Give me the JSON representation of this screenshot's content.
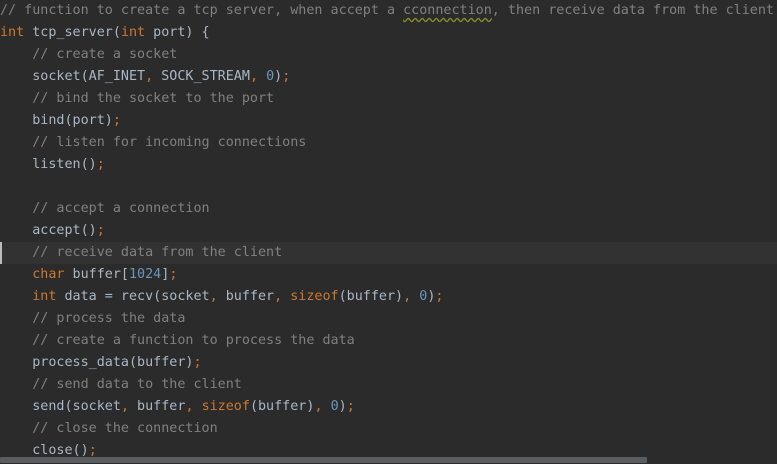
{
  "editor": {
    "current_line_index": 11,
    "lines": [
      {
        "tokens": [
          {
            "text": "// function to create a tcp server, when accept a ",
            "type": "comment"
          },
          {
            "text": "cconnection",
            "type": "comment typo"
          },
          {
            "text": ", then receive data from the client",
            "type": "comment"
          }
        ]
      },
      {
        "tokens": [
          {
            "text": "int",
            "type": "keyword"
          },
          {
            "text": " tcp_server(",
            "type": "fn"
          },
          {
            "text": "int",
            "type": "keyword"
          },
          {
            "text": " port) {",
            "type": "fn"
          }
        ]
      },
      {
        "tokens": [
          {
            "text": "    // create a socket",
            "type": "comment"
          }
        ]
      },
      {
        "tokens": [
          {
            "text": "    socket(AF_INET",
            "type": "fn"
          },
          {
            "text": ",",
            "type": "punct"
          },
          {
            "text": " SOCK_STREAM",
            "type": "fn"
          },
          {
            "text": ",",
            "type": "punct"
          },
          {
            "text": " ",
            "type": "fn"
          },
          {
            "text": "0",
            "type": "number"
          },
          {
            "text": ")",
            "type": "fn"
          },
          {
            "text": ";",
            "type": "punct"
          }
        ]
      },
      {
        "tokens": [
          {
            "text": "    // bind the socket to the port",
            "type": "comment"
          }
        ]
      },
      {
        "tokens": [
          {
            "text": "    bind(port)",
            "type": "fn"
          },
          {
            "text": ";",
            "type": "punct"
          }
        ]
      },
      {
        "tokens": [
          {
            "text": "    // listen for incoming connections",
            "type": "comment"
          }
        ]
      },
      {
        "tokens": [
          {
            "text": "    listen()",
            "type": "fn"
          },
          {
            "text": ";",
            "type": "punct"
          }
        ]
      },
      {
        "tokens": [
          {
            "text": "",
            "type": "fn"
          }
        ]
      },
      {
        "tokens": [
          {
            "text": "    // accept a connection",
            "type": "comment"
          }
        ]
      },
      {
        "tokens": [
          {
            "text": "    accept()",
            "type": "fn"
          },
          {
            "text": ";",
            "type": "punct"
          }
        ]
      },
      {
        "tokens": [
          {
            "text": "    // receive data from the client",
            "type": "comment"
          }
        ]
      },
      {
        "tokens": [
          {
            "text": "    ",
            "type": "fn"
          },
          {
            "text": "char",
            "type": "keyword"
          },
          {
            "text": " buffer[",
            "type": "fn"
          },
          {
            "text": "1024",
            "type": "number"
          },
          {
            "text": "]",
            "type": "fn"
          },
          {
            "text": ";",
            "type": "punct"
          }
        ]
      },
      {
        "tokens": [
          {
            "text": "    ",
            "type": "fn"
          },
          {
            "text": "int",
            "type": "keyword"
          },
          {
            "text": " data = recv(socket",
            "type": "fn"
          },
          {
            "text": ",",
            "type": "punct"
          },
          {
            "text": " buffer",
            "type": "fn"
          },
          {
            "text": ",",
            "type": "punct"
          },
          {
            "text": " ",
            "type": "fn"
          },
          {
            "text": "sizeof",
            "type": "keyword"
          },
          {
            "text": "(buffer)",
            "type": "fn"
          },
          {
            "text": ",",
            "type": "punct"
          },
          {
            "text": " ",
            "type": "fn"
          },
          {
            "text": "0",
            "type": "number"
          },
          {
            "text": ")",
            "type": "fn"
          },
          {
            "text": ";",
            "type": "punct"
          }
        ]
      },
      {
        "tokens": [
          {
            "text": "    // process the data",
            "type": "comment"
          }
        ]
      },
      {
        "tokens": [
          {
            "text": "    // create a function to process the data",
            "type": "comment"
          }
        ]
      },
      {
        "tokens": [
          {
            "text": "    process_data(buffer)",
            "type": "fn"
          },
          {
            "text": ";",
            "type": "punct"
          }
        ]
      },
      {
        "tokens": [
          {
            "text": "    // send data to the client",
            "type": "comment"
          }
        ]
      },
      {
        "tokens": [
          {
            "text": "    send(socket",
            "type": "fn"
          },
          {
            "text": ",",
            "type": "punct"
          },
          {
            "text": " buffer",
            "type": "fn"
          },
          {
            "text": ",",
            "type": "punct"
          },
          {
            "text": " ",
            "type": "fn"
          },
          {
            "text": "sizeof",
            "type": "keyword"
          },
          {
            "text": "(buffer)",
            "type": "fn"
          },
          {
            "text": ",",
            "type": "punct"
          },
          {
            "text": " ",
            "type": "fn"
          },
          {
            "text": "0",
            "type": "number"
          },
          {
            "text": ")",
            "type": "fn"
          },
          {
            "text": ";",
            "type": "punct"
          }
        ]
      },
      {
        "tokens": [
          {
            "text": "    // close the connection",
            "type": "comment"
          }
        ]
      },
      {
        "tokens": [
          {
            "text": "    close()",
            "type": "fn"
          },
          {
            "text": ";",
            "type": "punct"
          }
        ]
      }
    ]
  },
  "colors": {
    "background": "#2b2b2b",
    "current_line": "#323232",
    "comment": "#808080",
    "keyword": "#cc7832",
    "number": "#6897bb",
    "text": "#a9b7c6"
  }
}
